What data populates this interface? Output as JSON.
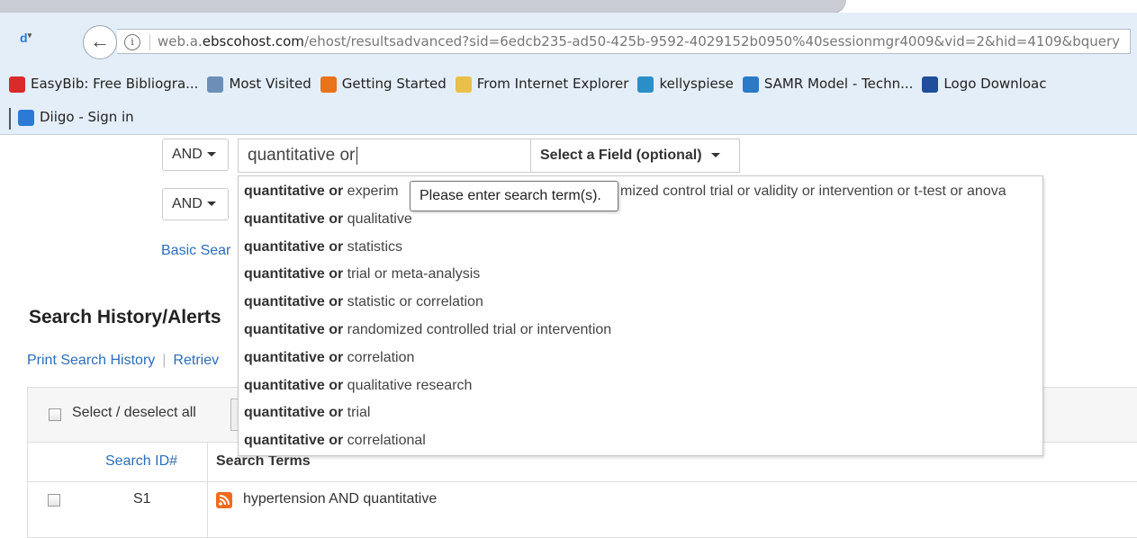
{
  "browser": {
    "url_host": "web.a.ebscohost.com",
    "url_rest": "/ehost/resultsadvanced?sid=6edcb235-ad50-425b-9592-4029152b0950%40sessionmgr4009&vid=2&hid=4109&bquery",
    "url_prefix": "web.a.",
    "url_domain": "ebscohost.com",
    "diigo_button": "d",
    "bookmarks": [
      {
        "label": "EasyBib: Free Bibliogra...",
        "icon": "easybib-icon",
        "color": "#d92b2b"
      },
      {
        "label": "Most Visited",
        "icon": "most-visited-icon",
        "color": "#6c8fb8"
      },
      {
        "label": "Getting Started",
        "icon": "firefox-icon",
        "color": "#e8731a"
      },
      {
        "label": "From Internet Explorer",
        "icon": "folder-icon",
        "color": "#e8c04a"
      },
      {
        "label": "kellyspiese",
        "icon": "wordpress-icon",
        "color": "#2b8fc7"
      },
      {
        "label": "SAMR Model - Techn...",
        "icon": "page-icon",
        "color": "#2b7ac7"
      },
      {
        "label": "Logo Downloac",
        "icon": "wordpress-icon",
        "color": "#1f4f9a"
      }
    ],
    "bookmarks_row2": [
      {
        "label": "Diigo - Sign in",
        "icon": "diigo-icon",
        "color": "#2a7ad6"
      }
    ]
  },
  "search": {
    "operator_1": "AND",
    "operator_2": "AND",
    "input_value": "quantitative or",
    "field_select": "Select a Field (optional)",
    "basic_search_link": "Basic Sear",
    "tooltip": "Please enter search term(s).",
    "suggestion_prefix": "quantitative or",
    "suggestions": [
      " experim",
      " qualitative",
      " statistics",
      " trial or meta-analysis",
      " statistic or correlation",
      " randomized controlled trial or intervention",
      " correlation",
      " qualitative research",
      " trial",
      " correlational"
    ],
    "suggestion_1_tail": "mized control trial or validity or intervention or t-test or anova"
  },
  "history": {
    "title": "Search History/Alerts",
    "print_link": "Print Search History",
    "retrieve_link": "Retriev",
    "select_all": "Select / deselect all",
    "col_search_id": "Search ID#",
    "col_search_terms": "Search Terms",
    "rows": [
      {
        "id": "S1",
        "terms": "hypertension AND quantitative"
      }
    ]
  }
}
